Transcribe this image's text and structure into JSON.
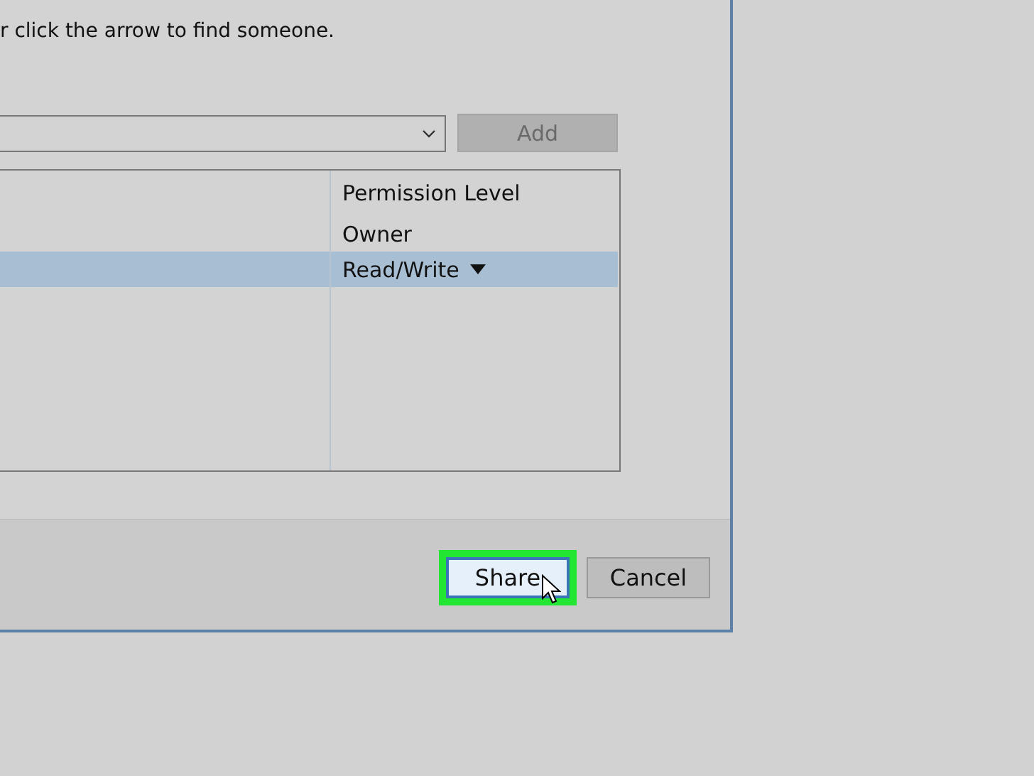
{
  "instruction": "r click the arrow to find someone.",
  "add_button": {
    "label": "Add",
    "disabled": true
  },
  "permissions_list": {
    "columns": [
      "Permission Level"
    ],
    "rows": [
      {
        "permission": "Owner",
        "selected": false
      },
      {
        "permission": "Read/Write",
        "selected": true
      }
    ]
  },
  "buttons": [
    {
      "label": "Share",
      "kind": "default",
      "highlighted": true
    },
    {
      "label": "Cancel",
      "kind": "normal",
      "highlighted": false
    }
  ]
}
